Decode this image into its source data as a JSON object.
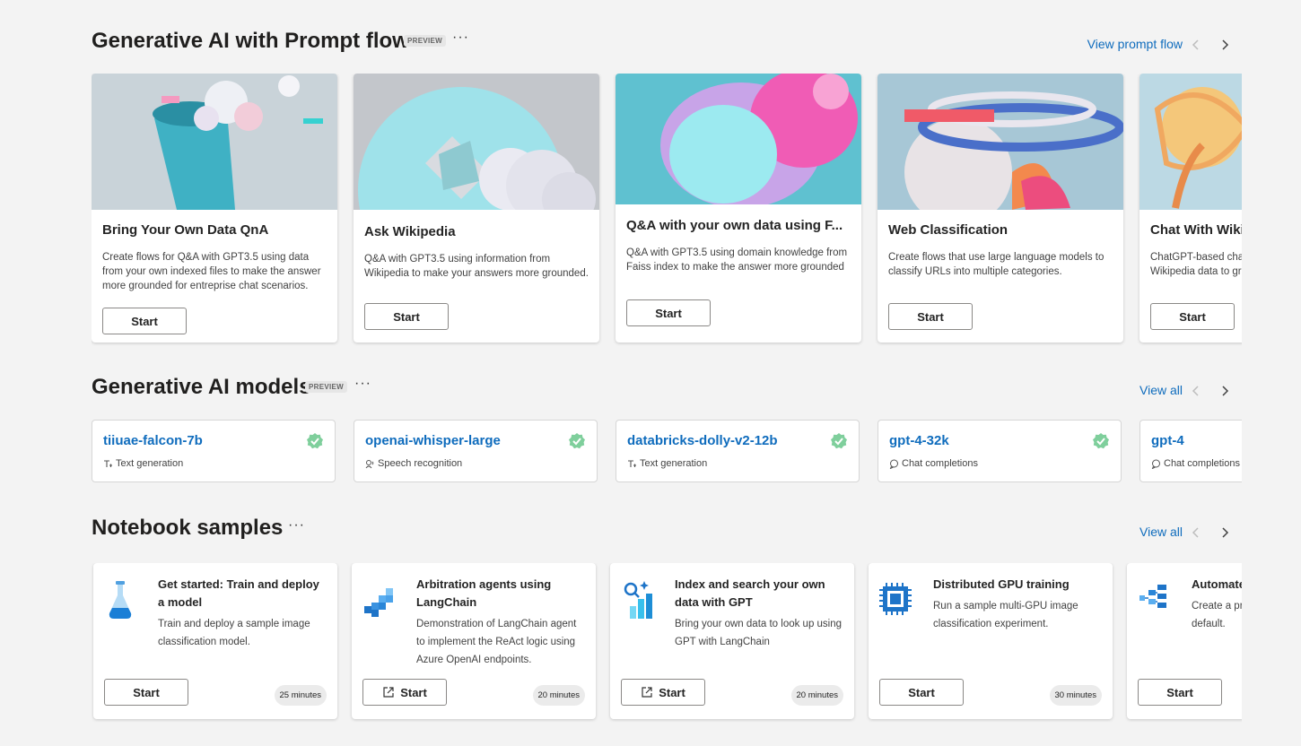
{
  "prompt_flow": {
    "title": "Generative AI with Prompt flow",
    "badge": "PREVIEW",
    "more": "···",
    "view_link": "View prompt flow",
    "cards": [
      {
        "title": "Bring Your Own Data QnA",
        "desc": "Create flows for Q&A with GPT3.5 using data from your own indexed files to make the answer more grounded for entreprise chat scenarios.",
        "button": "Start"
      },
      {
        "title": "Ask Wikipedia",
        "desc": "Q&A with GPT3.5 using information from Wikipedia to make your answers more grounded.",
        "button": "Start"
      },
      {
        "title": "Q&A with your own data using F...",
        "desc": "Q&A with GPT3.5 using domain knowledge from Faiss index to make the answer more grounded",
        "button": "Start"
      },
      {
        "title": "Web Classification",
        "desc": "Create flows that use large language models to classify URLs into multiple categories.",
        "button": "Start"
      },
      {
        "title": "Chat With Wikipedia",
        "desc": "ChatGPT-based chatbot that leverages Wikipedia data to ground its responses.",
        "button": "Start"
      }
    ]
  },
  "models": {
    "title": "Generative AI models",
    "badge": "PREVIEW",
    "more": "···",
    "view_link": "View all",
    "cards": [
      {
        "name": "tiiuae-falcon-7b",
        "task": "Text generation",
        "task_icon": "text-generation-icon"
      },
      {
        "name": "openai-whisper-large",
        "task": "Speech recognition",
        "task_icon": "speech-icon"
      },
      {
        "name": "databricks-dolly-v2-12b",
        "task": "Text generation",
        "task_icon": "text-generation-icon"
      },
      {
        "name": "gpt-4-32k",
        "task": "Chat completions",
        "task_icon": "chat-icon"
      },
      {
        "name": "gpt-4",
        "task": "Chat completions",
        "task_icon": "chat-icon"
      }
    ]
  },
  "notebooks": {
    "title": "Notebook samples",
    "more": "···",
    "view_link": "View all",
    "cards": [
      {
        "title": "Get started: Train and deploy a model",
        "desc": "Train and deploy a sample image classification model.",
        "button": "Start",
        "time": "25 minutes",
        "icon": "flask-icon"
      },
      {
        "title": "Arbitration agents using LangChain",
        "desc": "Demonstration of LangChain agent to implement the ReAct logic using Azure OpenAI endpoints.",
        "button": "Start",
        "time": "20 minutes",
        "icon": "blocks-icon"
      },
      {
        "title": "Index and search your own data with GPT",
        "desc": "Bring your own data to look up using GPT with LangChain",
        "button": "Start",
        "time": "20 minutes",
        "icon": "index-search-icon"
      },
      {
        "title": "Distributed GPU training",
        "desc": "Run a sample multi-GPU image classification experiment.",
        "button": "Start",
        "time": "30 minutes",
        "icon": "gpu-chip-icon"
      },
      {
        "title": "Automated ML",
        "desc": "Create a predictive model for credit default.",
        "button": "Start",
        "time": "",
        "icon": "automl-icon"
      }
    ]
  },
  "colors": {
    "accent": "#0f6cbd",
    "verified": "#7fcf9c",
    "background": "#f3f3f3"
  }
}
